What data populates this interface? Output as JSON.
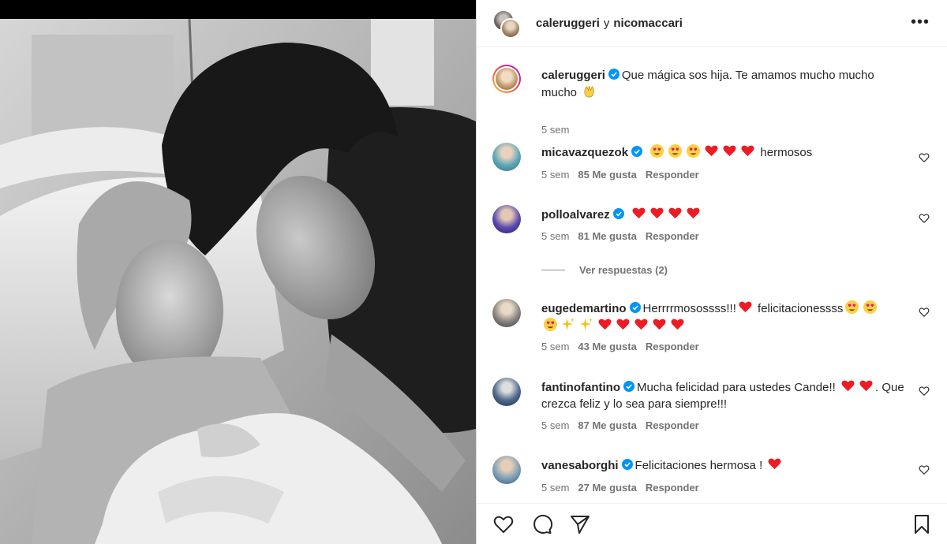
{
  "header": {
    "user1": "caleruggeri",
    "conjunction": "y",
    "user2": "nicomaccari",
    "more_icon": "more-options-icon"
  },
  "caption": {
    "username": "caleruggeri",
    "text": "Que mágica sos hija. Te amamos mucho mucho mucho",
    "emoji": "hands-emoji",
    "time": "5 sem"
  },
  "comments": [
    {
      "username": "micavazquezok",
      "text": "hermosos",
      "emojis": [
        "heart-eyes",
        "heart-eyes",
        "heart-eyes",
        "red-heart",
        "red-heart",
        "red-heart"
      ],
      "time": "5 sem",
      "likes": "85 Me gusta",
      "reply": "Responder"
    },
    {
      "username": "polloalvarez",
      "text": "",
      "emojis": [
        "red-heart",
        "red-heart",
        "red-heart",
        "red-heart"
      ],
      "time": "5 sem",
      "likes": "81 Me gusta",
      "reply": "Responder"
    },
    {
      "username": "eugedemartino",
      "text1": "Herrrrmosossss!!!",
      "text2": "felicitacionessss",
      "time": "5 sem",
      "likes": "43 Me gusta",
      "reply": "Responder"
    },
    {
      "username": "fantinofantino",
      "text1": "Mucha felicidad para ustedes Cande!!",
      "text2": ". Que crezca feliz y lo sea para siempre!!!",
      "time": "5 sem",
      "likes": "87 Me gusta",
      "reply": "Responder"
    },
    {
      "username": "vanesaborghi",
      "text": "Felicitaciones hermosa !",
      "time": "5 sem",
      "likes": "27 Me gusta",
      "reply": "Responder"
    }
  ],
  "view_replies": "Ver respuestas (2)",
  "actions": {
    "like_icon": "heart-outline-icon",
    "comment_icon": "comment-icon",
    "share_icon": "share-icon",
    "save_icon": "bookmark-icon"
  },
  "colors": {
    "verified": "#0095f6",
    "heart": "#ed1c24",
    "meta_text": "#737373"
  }
}
